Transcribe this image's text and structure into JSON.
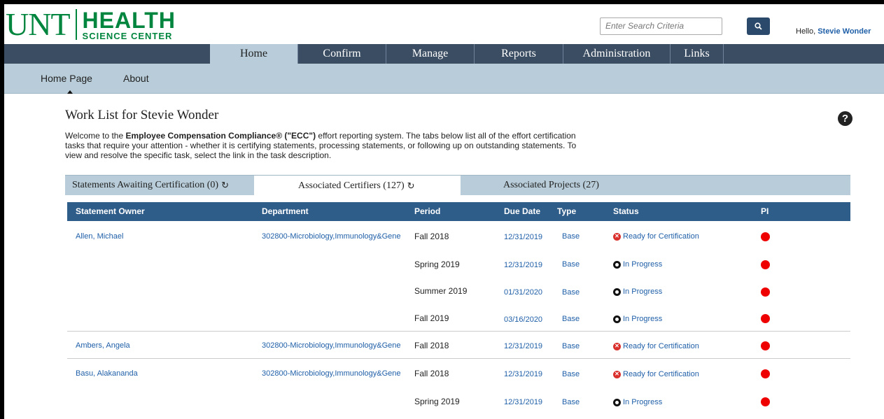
{
  "header": {
    "logo_unt": "UNT",
    "logo_health": "HEALTH",
    "logo_sub": "SCIENCE CENTER",
    "search_placeholder": "Enter Search Criteria",
    "hello_prefix": "Hello,",
    "user_name": "Stevie Wonder"
  },
  "topnav": [
    {
      "label": "Home",
      "active": true
    },
    {
      "label": "Confirm",
      "active": false
    },
    {
      "label": "Manage",
      "active": false
    },
    {
      "label": "Reports",
      "active": false
    },
    {
      "label": "Administration",
      "active": false
    },
    {
      "label": "Links",
      "active": false
    }
  ],
  "subnav": [
    {
      "label": "Home Page",
      "active": true
    },
    {
      "label": "About",
      "active": false
    }
  ],
  "page": {
    "title": "Work List for Stevie Wonder",
    "welcome_pre": "Welcome to the ",
    "welcome_bold": "Employee Compensation Compliance® (\"ECC\")",
    "welcome_post": " effort reporting system. The tabs below list all of the effort certification tasks that require your attention - whether it is certifying statements, processing statements, or following up on outstanding statements. To view and resolve the specific task, select the link in the task description."
  },
  "tabs": [
    {
      "label": "Statements Awaiting Certification (0)",
      "active": false,
      "refresh": true
    },
    {
      "label": "Associated Certifiers (127)",
      "active": true,
      "refresh": true
    },
    {
      "label": "Associated Projects (27)",
      "active": false,
      "refresh": false
    }
  ],
  "table": {
    "columns": [
      "Statement Owner",
      "Department",
      "Period",
      "Due Date",
      "Type",
      "Status",
      "PI"
    ],
    "rows": [
      {
        "owner": "Allen, Michael",
        "dept": "302800-Microbiology,Immunology&Gene",
        "period": "Fall 2018",
        "due": "12/31/2019",
        "type": "Base",
        "status": "Ready for Certification",
        "status_kind": "ready"
      },
      {
        "owner": "",
        "dept": "",
        "period": "Spring 2019",
        "due": "12/31/2019",
        "type": "Base",
        "status": "In Progress",
        "status_kind": "progress"
      },
      {
        "owner": "",
        "dept": "",
        "period": "Summer 2019",
        "due": "01/31/2020",
        "type": "Base",
        "status": "In Progress",
        "status_kind": "progress"
      },
      {
        "owner": "",
        "dept": "",
        "period": "Fall 2019",
        "due": "03/16/2020",
        "type": "Base",
        "status": "In Progress",
        "status_kind": "progress"
      },
      {
        "owner": "Ambers, Angela",
        "dept": "302800-Microbiology,Immunology&Gene",
        "period": "Fall 2018",
        "due": "12/31/2019",
        "type": "Base",
        "status": "Ready for Certification",
        "status_kind": "ready"
      },
      {
        "owner": "Basu, Alakananda",
        "dept": "302800-Microbiology,Immunology&Gene",
        "period": "Fall 2018",
        "due": "12/31/2019",
        "type": "Base",
        "status": "Ready for Certification",
        "status_kind": "ready"
      },
      {
        "owner": "",
        "dept": "",
        "period": "Spring 2019",
        "due": "12/31/2019",
        "type": "Base",
        "status": "In Progress",
        "status_kind": "progress"
      }
    ]
  },
  "colors": {
    "nav_bg": "#3b4d62",
    "subnav_bg": "#b8cdd9",
    "table_header": "#2f5d8a",
    "brand_green": "#00853e",
    "pi_red": "#ee0000"
  }
}
